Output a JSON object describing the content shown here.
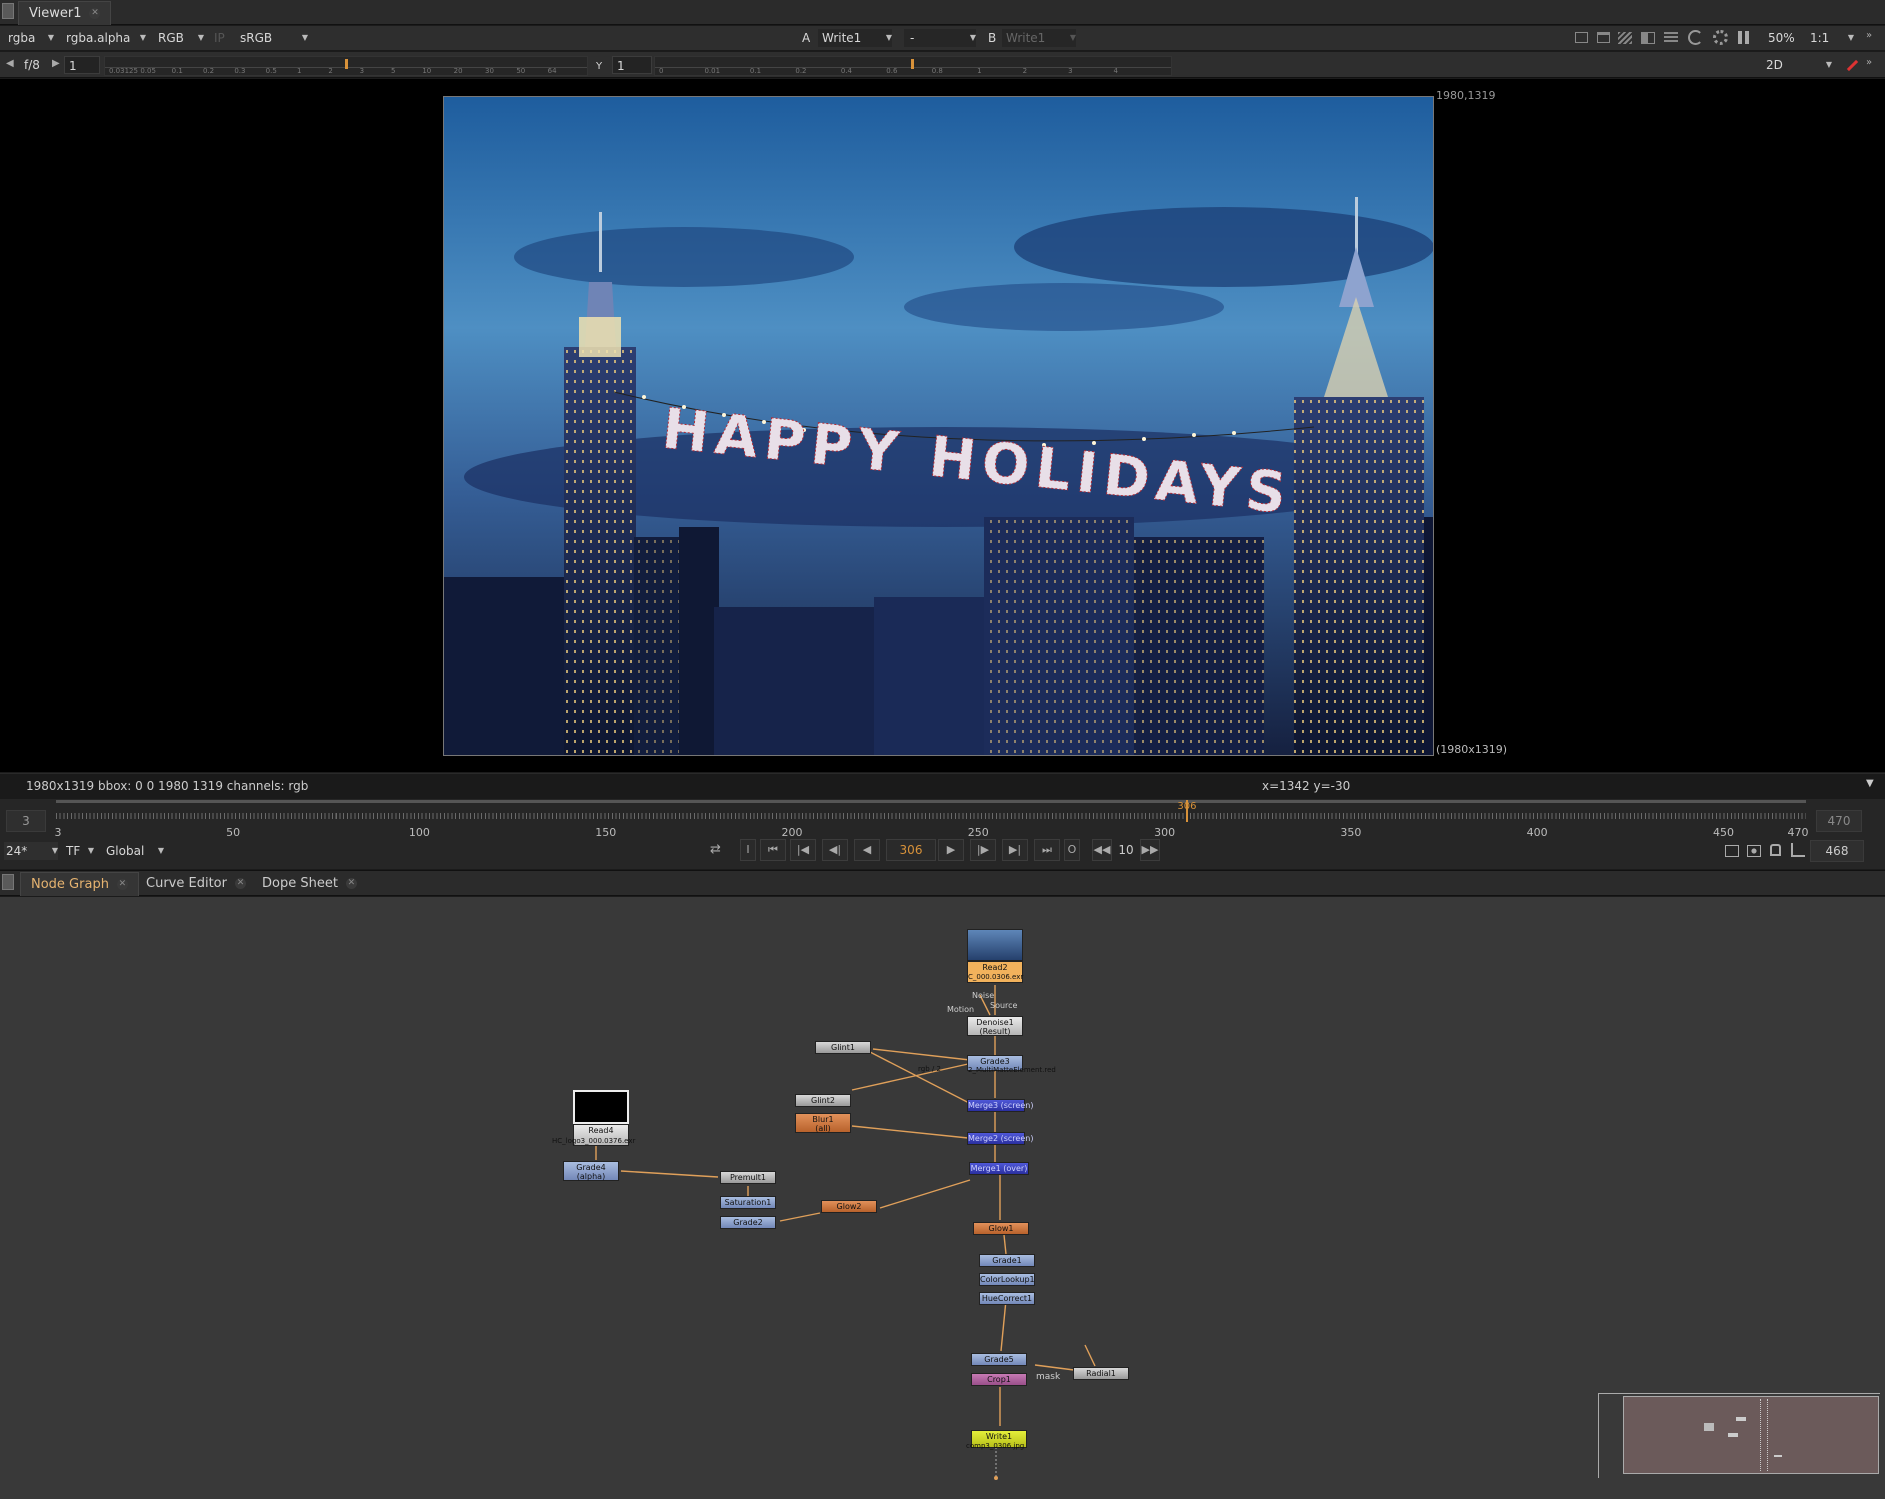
{
  "viewer_tab": {
    "label": "Viewer1"
  },
  "toolbar1": {
    "channels": "rgba",
    "alpha_channel": "rgba.alpha",
    "display_channels": "RGB",
    "ip_label": "IP",
    "colorspace": "sRGB",
    "a_label": "A",
    "a_input": "Write1",
    "compare_op": "-",
    "b_label": "B",
    "b_input": "Write1",
    "zoom": "50%",
    "proxy": "1:1"
  },
  "toolbar2": {
    "fstop": "f/8",
    "gain_value": "1",
    "gain_ticks": [
      "0.03125",
      "0.05",
      "0.1",
      "0.2",
      "0.3",
      "0.5",
      "1",
      "2",
      "3",
      "5",
      "10",
      "20",
      "30",
      "50",
      "64"
    ],
    "y_label": "Y",
    "gamma_value": "1",
    "gamma_ticks": [
      "0",
      "0.01",
      "0.1",
      "0.2",
      "0.4",
      "0.6",
      "0.8",
      "1",
      "2",
      "3",
      "4"
    ],
    "view_mode": "2D"
  },
  "viewer": {
    "format_top_right": "1980,1319",
    "format_bottom_right": "(1980x1319)",
    "image_text": "HAPPY HOLIDAYS"
  },
  "info_bar": {
    "info": "1980x1319  bbox: 0 0 1980 1319 channels: rgb",
    "coords": "x=1342 y=-30"
  },
  "timeline": {
    "in_frame": "3",
    "out_frame": "470",
    "current_frame_marker": "306",
    "labels": [
      "3",
      "50",
      "100",
      "150",
      "200",
      "250",
      "300",
      "350",
      "400",
      "450",
      "470"
    ],
    "label_values": [
      3,
      50,
      100,
      150,
      200,
      250,
      300,
      350,
      400,
      450,
      470
    ],
    "fps": "24*",
    "tf": "TF",
    "scope": "Global",
    "current_frame": "306",
    "step": "10",
    "end_frame": "468"
  },
  "panel_tabs": [
    {
      "label": "Node Graph"
    },
    {
      "label": "Curve Editor"
    },
    {
      "label": "Dope Sheet"
    }
  ],
  "nodes": {
    "read2": {
      "label": "Read2",
      "file": "C_000.0306.exr"
    },
    "denoise1": {
      "label": "Denoise1",
      "sub": "(Result)",
      "in_noise": "Noise",
      "in_source": "Source",
      "in_motion": "Motion"
    },
    "grade3": {
      "label": "Grade3",
      "sub": "2_MultiMatteElement.red"
    },
    "glint1": {
      "label": "Glint1"
    },
    "glint2": {
      "label": "Glint2"
    },
    "blur1": {
      "label": "Blur1",
      "sub": "(all)"
    },
    "merge3": {
      "label": "Merge3 (screen)"
    },
    "merge2": {
      "label": "Merge2 (screen)"
    },
    "merge1": {
      "label": "Merge1 (over)"
    },
    "read4": {
      "label": "Read4",
      "file": "HC_logo3_000.0376.exr"
    },
    "grade4": {
      "label": "Grade4",
      "sub": "(alpha)"
    },
    "premult1": {
      "label": "Premult1"
    },
    "saturation1": {
      "label": "Saturation1"
    },
    "grade2": {
      "label": "Grade2"
    },
    "glow2": {
      "label": "Glow2"
    },
    "glow1": {
      "label": "Glow1"
    },
    "grade1": {
      "label": "Grade1"
    },
    "colorlookup1": {
      "label": "ColorLookup1"
    },
    "huecorrect1": {
      "label": "HueCorrect1"
    },
    "grade5": {
      "label": "Grade5"
    },
    "crop1": {
      "label": "Crop1"
    },
    "radial1": {
      "label": "Radial1"
    },
    "mask_label": "mask",
    "rgb_label": "rgb / 2",
    "write1": {
      "label": "Write1",
      "file": "comp3_0306.jpg"
    }
  }
}
